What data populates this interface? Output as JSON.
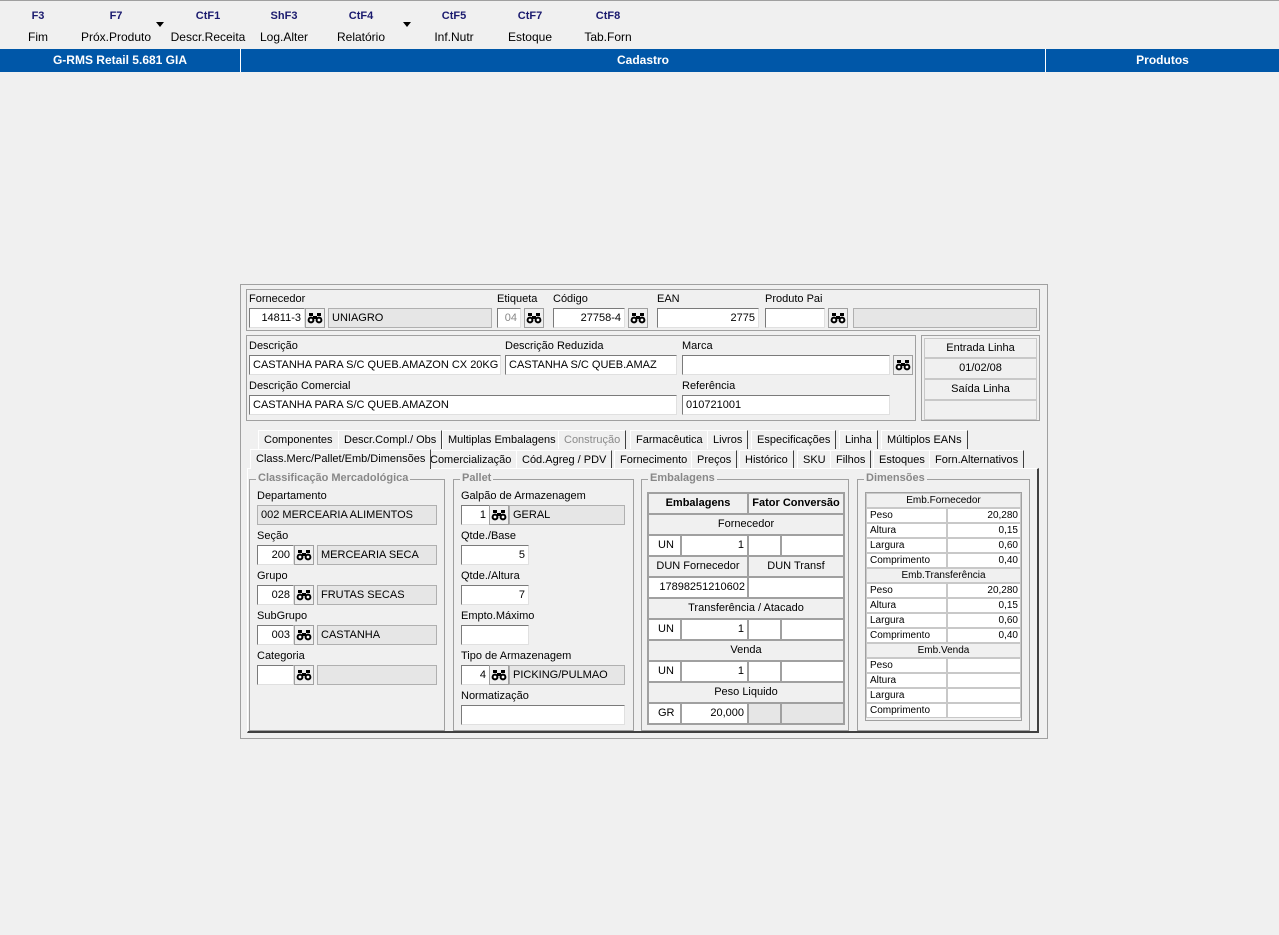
{
  "toolbar": {
    "items": [
      {
        "key": "F3",
        "label": "Fim"
      },
      {
        "key": "F7",
        "label": "Próx.Produto"
      },
      {
        "key": "CtF1",
        "label": "Descr.Receita"
      },
      {
        "key": "ShF3",
        "label": "Log.Alter"
      },
      {
        "key": "CtF4",
        "label": "Relatório"
      },
      {
        "key": "CtF5",
        "label": "Inf.Nutr"
      },
      {
        "key": "CtF7",
        "label": "Estoque"
      },
      {
        "key": "CtF8",
        "label": "Tab.Forn"
      }
    ]
  },
  "titlebar": {
    "app": "G-RMS Retail 5.681 GIA",
    "module": "Cadastro",
    "screen": "Produtos"
  },
  "header": {
    "fornecedor_label": "Fornecedor",
    "fornecedor_code": "14811-3",
    "fornecedor_name": "UNIAGRO",
    "etiqueta_label": "Etiqueta",
    "etiqueta_value": "04",
    "codigo_label": "Código",
    "codigo_value": "27758-4",
    "ean_label": "EAN",
    "ean_value": "2775",
    "produto_pai_label": "Produto Pai",
    "produto_pai_value": "",
    "produto_pai_desc": ""
  },
  "desc": {
    "descricao_label": "Descrição",
    "descricao_value": "CASTANHA PARA S/C QUEB.AMAZON    CX 20KG",
    "reduzida_label": "Descrição Reduzida",
    "reduzida_value": "CASTANHA S/C QUEB.AMAZ",
    "marca_label": "Marca",
    "marca_value": "",
    "comercial_label": "Descrição Comercial",
    "comercial_value": "CASTANHA PARA S/C QUEB.AMAZON",
    "referencia_label": "Referência",
    "referencia_value": "010721001"
  },
  "linha": {
    "entrada_label": "Entrada Linha",
    "entrada_value": "01/02/08",
    "saida_label": "Saída Linha",
    "saida_value": ""
  },
  "tabs_row1": [
    "Componentes",
    "Descr.Compl./ Obs",
    "Multiplas Embalagens",
    "Construção",
    "Farmacêutica",
    "Livros",
    "Especificações",
    "Linha",
    "Múltiplos EANs"
  ],
  "tabs_row2": [
    "Class.Merc/Pallet/Emb/Dimensões",
    "Comercialização",
    "Cód.Agreg / PDV",
    "Fornecimento",
    "Preços",
    "Histórico",
    "SKU",
    "Filhos",
    "Estoques",
    "Forn.Alternativos"
  ],
  "classificacao": {
    "title": "Classificação Mercadológica",
    "departamento_label": "Departamento",
    "departamento_value": "002 MERCEARIA ALIMENTOS",
    "secao_label": "Seção",
    "secao_code": "200",
    "secao_name": "MERCEARIA SECA",
    "grupo_label": "Grupo",
    "grupo_code": "028",
    "grupo_name": "FRUTAS SECAS",
    "subgrupo_label": "SubGrupo",
    "subgrupo_code": "003",
    "subgrupo_name": "CASTANHA",
    "categoria_label": "Categoria",
    "categoria_code": "",
    "categoria_name": ""
  },
  "pallet": {
    "title": "Pallet",
    "galpao_label": "Galpão de Armazenagem",
    "galpao_code": "1",
    "galpao_name": "GERAL",
    "base_label": "Qtde./Base",
    "base_value": "5",
    "altura_label": "Qtde./Altura",
    "altura_value": "7",
    "empto_label": "Empto.Máximo",
    "empto_value": "",
    "tipo_label": "Tipo de Armazenagem",
    "tipo_code": "4",
    "tipo_name": "PICKING/PULMAO",
    "norm_label": "Normatização",
    "norm_value": ""
  },
  "embalagens": {
    "title": "Embalagens",
    "col1": "Embalagens",
    "col2": "Fator Conversão",
    "fornecedor": "Fornecedor",
    "forn_un": "UN",
    "forn_qty": "1",
    "dun_forn_label": "DUN Fornecedor",
    "dun_transf_label": "DUN Transf",
    "dun_forn_value": "17898251210602",
    "transf": "Transferência / Atacado",
    "transf_un": "UN",
    "transf_qty": "1",
    "venda": "Venda",
    "venda_un": "UN",
    "venda_qty": "1",
    "peso": "Peso Liquido",
    "peso_un": "GR",
    "peso_qty": "20,000"
  },
  "dimensoes": {
    "title": "Dimensões",
    "groups": [
      {
        "name": "Emb.Fornecedor",
        "rows": [
          [
            "Peso",
            "20,280"
          ],
          [
            "Altura",
            "0,15"
          ],
          [
            "Largura",
            "0,60"
          ],
          [
            "Comprimento",
            "0,40"
          ]
        ]
      },
      {
        "name": "Emb.Transferência",
        "rows": [
          [
            "Peso",
            "20,280"
          ],
          [
            "Altura",
            "0,15"
          ],
          [
            "Largura",
            "0,60"
          ],
          [
            "Comprimento",
            "0,40"
          ]
        ]
      },
      {
        "name": "Emb.Venda",
        "rows": [
          [
            "Peso",
            ""
          ],
          [
            "Altura",
            ""
          ],
          [
            "Largura",
            ""
          ],
          [
            "Comprimento",
            ""
          ]
        ]
      }
    ]
  }
}
